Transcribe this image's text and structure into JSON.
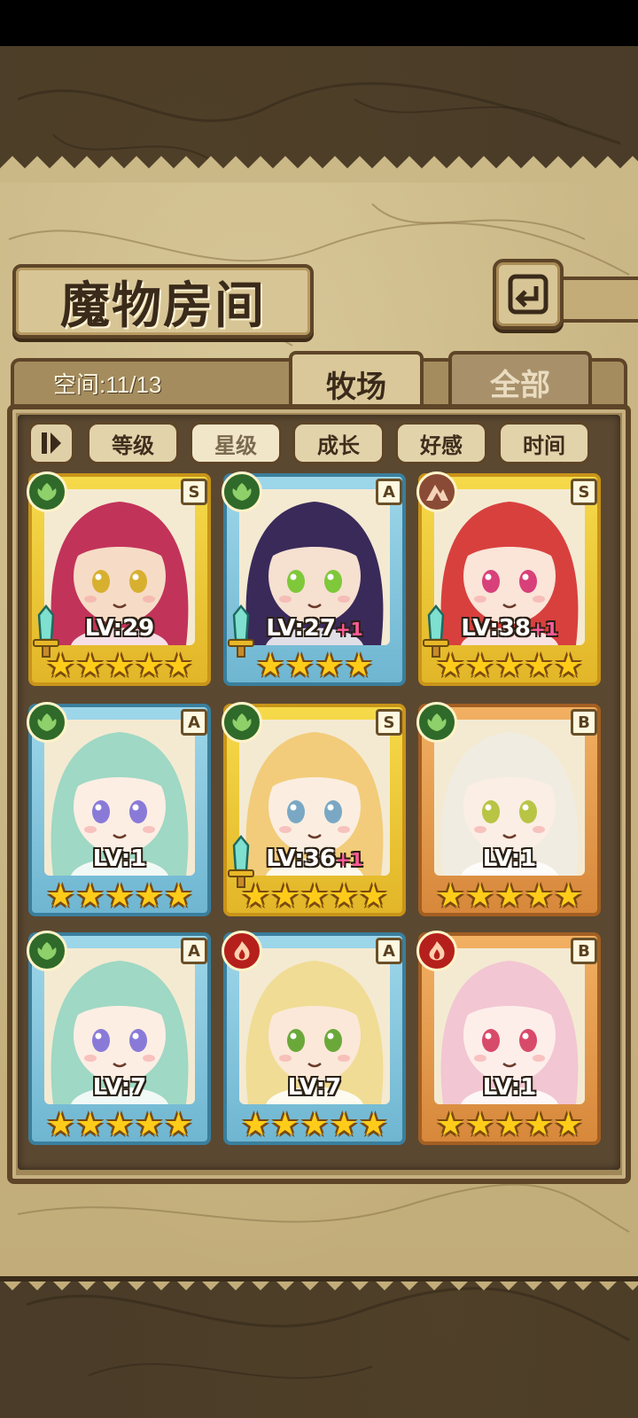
{
  "title": "魔物房间",
  "space_label": "空间:11/13",
  "tabs": [
    {
      "label": "牧场",
      "active": true
    },
    {
      "label": "全部",
      "active": false
    }
  ],
  "filters": [
    {
      "label": "等级",
      "active": false
    },
    {
      "label": "星级",
      "active": true
    },
    {
      "label": "成长",
      "active": false
    },
    {
      "label": "好感",
      "active": false
    },
    {
      "label": "时间",
      "active": false
    }
  ],
  "cards": [
    {
      "frame": "gold",
      "element": "nature",
      "rank": "S",
      "level": "LV:29",
      "plus": "",
      "stars": 5,
      "sword": true,
      "hair": "#c2335a",
      "skin": "#f6dcc6",
      "eyes": "#d8b030"
    },
    {
      "frame": "blue",
      "element": "nature",
      "rank": "A",
      "level": "LV:27",
      "plus": "+1",
      "stars": 4,
      "sword": true,
      "hair": "#3a2a5a",
      "skin": "#f6e0d0",
      "eyes": "#7ec83a"
    },
    {
      "frame": "gold",
      "element": "earth",
      "rank": "S",
      "level": "LV:38",
      "plus": "+1",
      "stars": 5,
      "sword": true,
      "hair": "#d8403e",
      "skin": "#fbe4d8",
      "eyes": "#d8407a"
    },
    {
      "frame": "blue",
      "element": "nature",
      "rank": "A",
      "level": "LV:1",
      "plus": "",
      "stars": 5,
      "sword": false,
      "hair": "#9fd8c4",
      "skin": "#fdeee4",
      "eyes": "#8a7ad8"
    },
    {
      "frame": "gold",
      "element": "nature",
      "rank": "S",
      "level": "LV:36",
      "plus": "+1",
      "stars": 5,
      "sword": true,
      "hair": "#f2cc7a",
      "skin": "#fbeee0",
      "eyes": "#7aa8c4"
    },
    {
      "frame": "bronze",
      "element": "nature",
      "rank": "B",
      "level": "LV:1",
      "plus": "",
      "stars": 5,
      "sword": false,
      "hair": "#f0ece2",
      "skin": "#fbeee4",
      "eyes": "#b8c444"
    },
    {
      "frame": "blue",
      "element": "nature",
      "rank": "A",
      "level": "LV:7",
      "plus": "",
      "stars": 5,
      "sword": false,
      "hair": "#9fd8c4",
      "skin": "#fdeee4",
      "eyes": "#8a7ad8"
    },
    {
      "frame": "blue",
      "element": "fire",
      "rank": "A",
      "level": "LV:7",
      "plus": "",
      "stars": 5,
      "sword": false,
      "hair": "#f0dc94",
      "skin": "#fbe8d8",
      "eyes": "#6aa83a"
    },
    {
      "frame": "bronze",
      "element": "fire",
      "rank": "B",
      "level": "LV:1",
      "plus": "",
      "stars": 5,
      "sword": false,
      "hair": "#f2c6d2",
      "skin": "#fdeeea",
      "eyes": "#d84a6a"
    }
  ]
}
